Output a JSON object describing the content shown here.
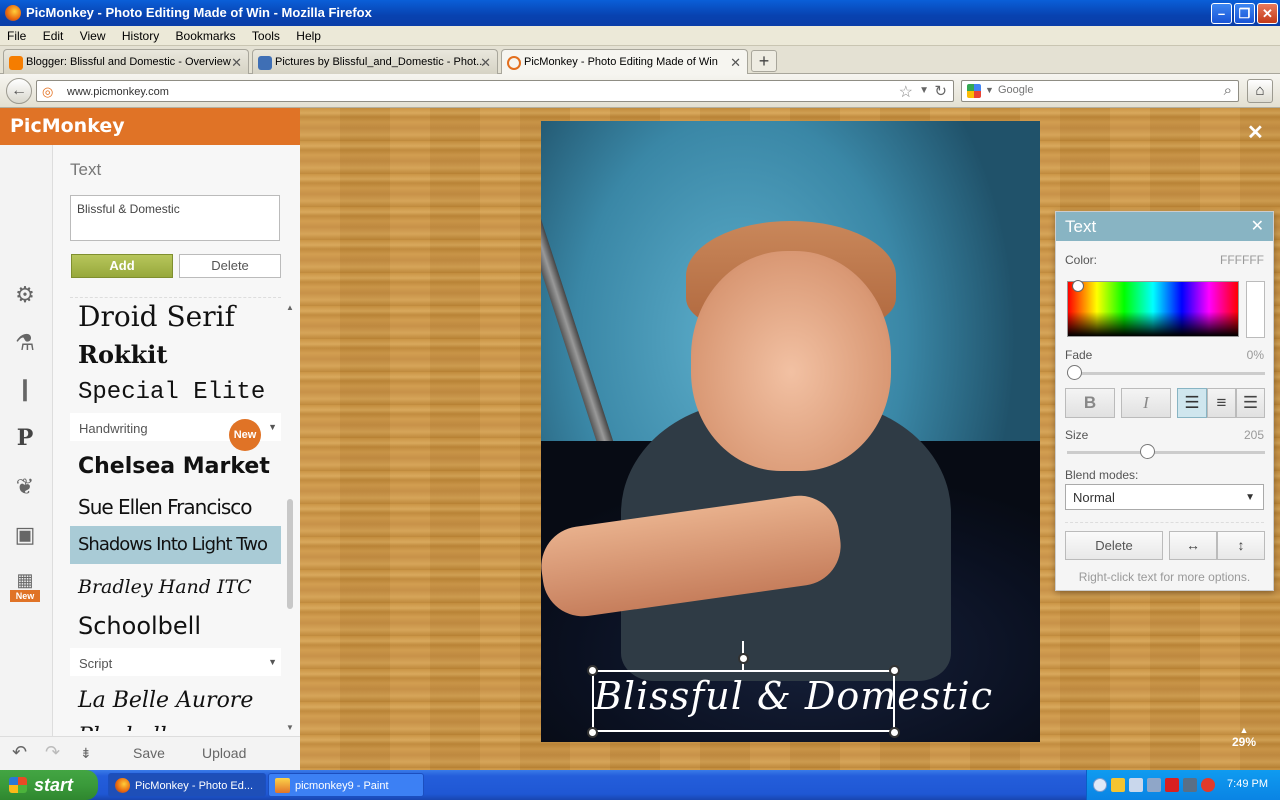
{
  "window": {
    "title": "PicMonkey - Photo Editing Made of Win - Mozilla Firefox"
  },
  "menu": [
    "File",
    "Edit",
    "View",
    "History",
    "Bookmarks",
    "Tools",
    "Help"
  ],
  "tabs": [
    {
      "label": "Blogger: Blissful and Domestic - Overview"
    },
    {
      "label": "Pictures by Blissful_and_Domestic - Phot..."
    },
    {
      "label": "PicMonkey - Photo Editing Made of Win"
    }
  ],
  "nav": {
    "url": "www.picmonkey.com",
    "search_placeholder": "Google"
  },
  "app": {
    "logo": "PicMonkey",
    "panel_title": "Text",
    "text_input_value": "Blissful & Domestic",
    "add_label": "Add",
    "delete_label": "Delete",
    "fonts": [
      "Droid Serif",
      "Rokkit",
      "Special Elite",
      "Chelsea Market",
      "Sue Ellen Francisco",
      "Shadows Into Light Two",
      "Bradley Hand ITC",
      "Schoolbell",
      "La Belle Aurore",
      "Playball"
    ],
    "categories": {
      "handwriting": "Handwriting",
      "script": "Script"
    },
    "new_badge": "New",
    "tool_new_badge": "New",
    "bottom": {
      "save": "Save",
      "upload": "Upload"
    },
    "overlay_text": "Blissful & Domestic",
    "zoom": "29%",
    "close_glyph": "✕"
  },
  "palette": {
    "title": "Text",
    "color_label": "Color:",
    "color_value": "FFFFFF",
    "fade_label": "Fade",
    "fade_value": "0%",
    "fade": 0,
    "bold": "B",
    "italic": "I",
    "size_label": "Size",
    "size_value": "205",
    "size_fraction": 0.4,
    "blend_label": "Blend modes:",
    "blend_value": "Normal",
    "delete_label": "Delete",
    "hint": "Right-click text for more options."
  },
  "taskbar": {
    "start": "start",
    "tasks": [
      {
        "label": "PicMonkey - Photo Ed..."
      },
      {
        "label": "picmonkey9 - Paint"
      }
    ],
    "clock": "7:49 PM"
  },
  "colors": {
    "accent": "#e07326",
    "palette_header": "#88b4c3",
    "selected_font": "#a9cbd6",
    "add_button": "#a6b74a"
  }
}
